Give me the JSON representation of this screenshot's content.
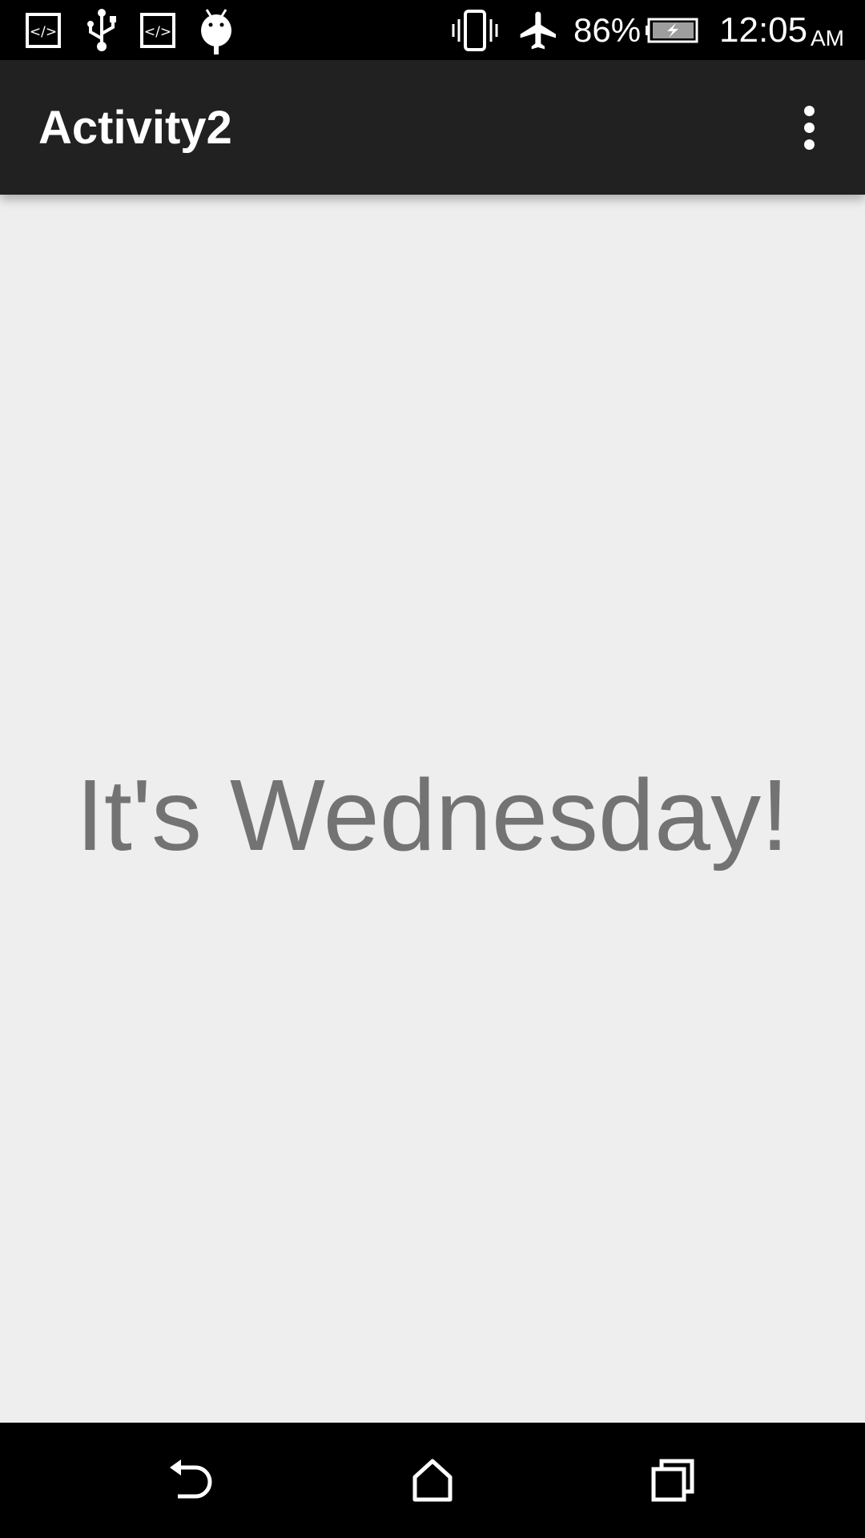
{
  "status_bar": {
    "icons_left": [
      "code-icon",
      "usb-icon",
      "code-icon",
      "android-debug-icon"
    ],
    "vibrate_icon": "vibrate-icon",
    "airplane_icon": "airplane-mode-icon",
    "battery_percent": "86%",
    "battery_icon": "battery-charging-icon",
    "time": "12:05",
    "ampm": "AM"
  },
  "app_bar": {
    "title": "Activity2",
    "overflow_icon": "more-vert-icon"
  },
  "main": {
    "message": "It's Wednesday!"
  },
  "nav_bar": {
    "back_icon": "back-icon",
    "home_icon": "home-icon",
    "recents_icon": "recents-icon"
  },
  "colors": {
    "status_bar_bg": "#000000",
    "app_bar_bg": "#212121",
    "content_bg": "#eeeeee",
    "message_text": "#737373",
    "nav_bar_bg": "#000000"
  }
}
